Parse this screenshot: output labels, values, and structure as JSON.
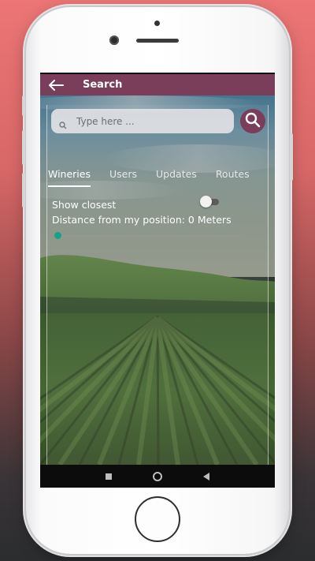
{
  "appbar": {
    "title": "Search"
  },
  "search": {
    "placeholder": "Type here ..."
  },
  "tabs": [
    {
      "label": "Wineries",
      "active": true
    },
    {
      "label": "Users",
      "active": false
    },
    {
      "label": "Updates",
      "active": false
    },
    {
      "label": "Routes",
      "active": false
    }
  ],
  "filters": {
    "show_closest_label": "Show closest",
    "show_closest_on": false,
    "distance_label": "Distance from my position: 0 Meters",
    "distance_value": 0
  },
  "colors": {
    "accent": "#7b3e5a",
    "slider": "#14a38a"
  },
  "icons": {
    "back": "back-arrow-icon",
    "search": "search-icon",
    "nav": [
      "recent-apps-icon",
      "home-icon",
      "back-icon"
    ]
  }
}
